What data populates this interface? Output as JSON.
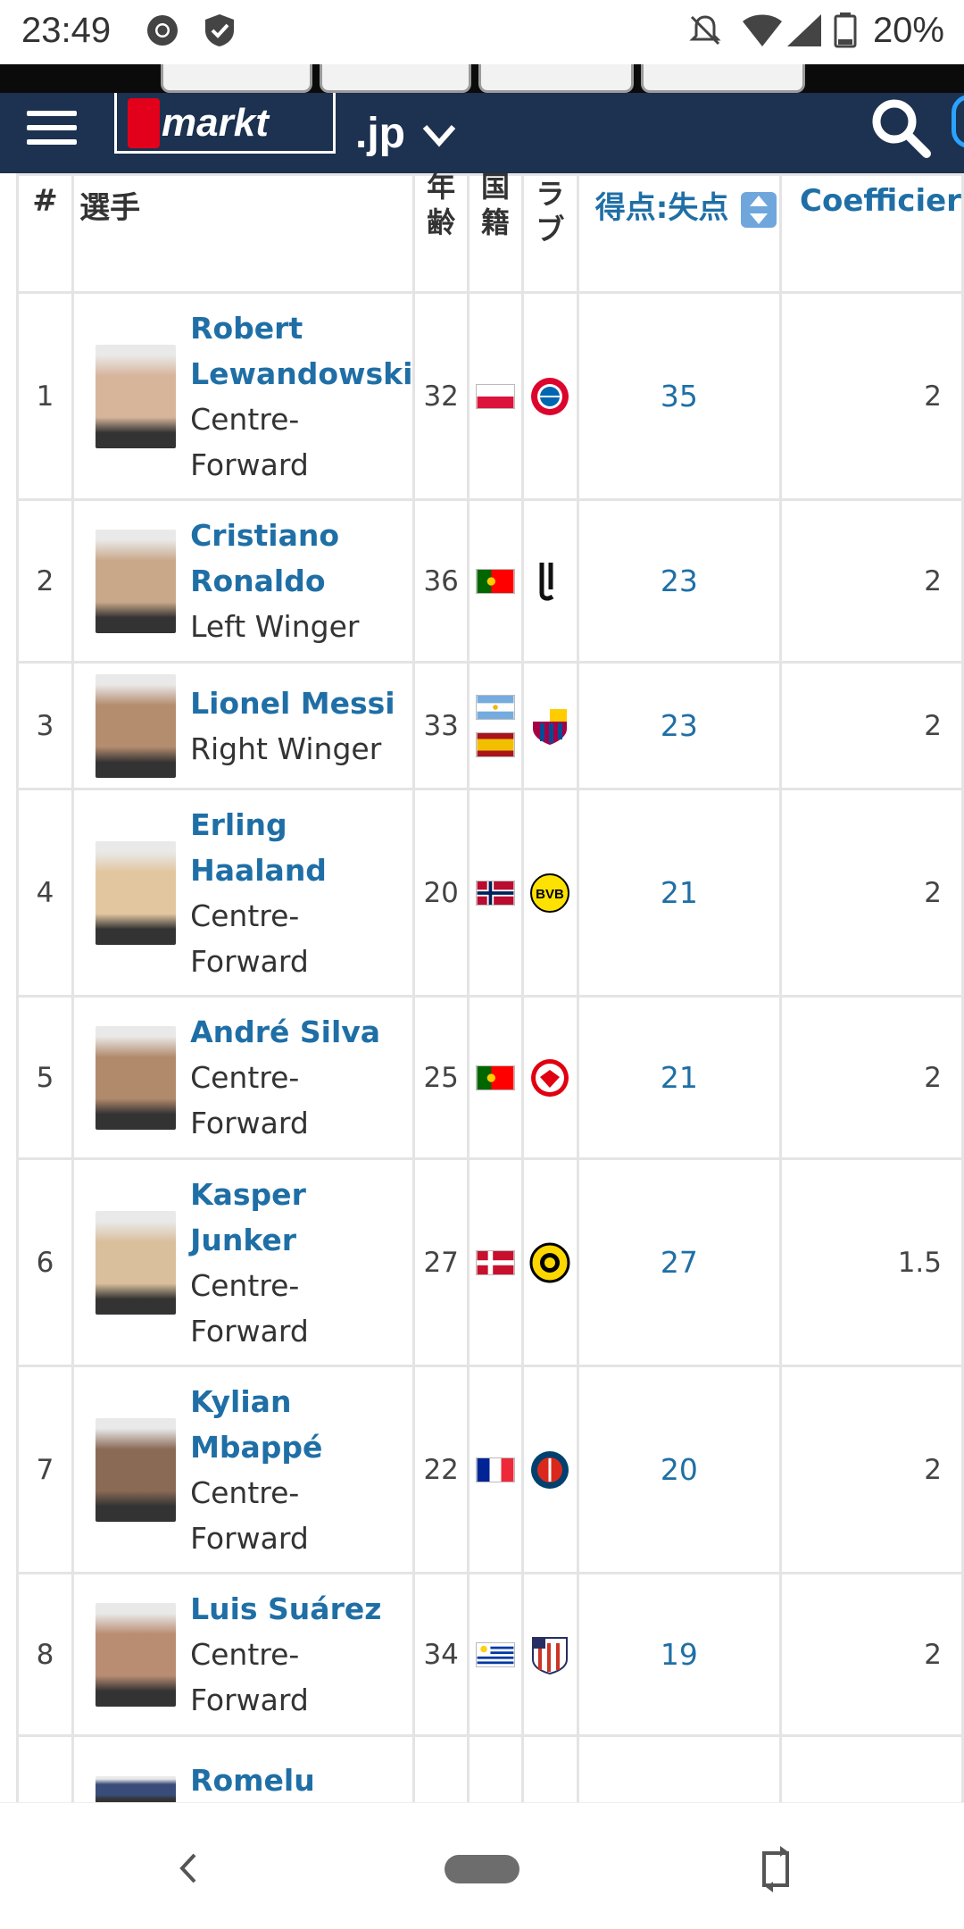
{
  "status_bar": {
    "time": "23:49",
    "battery_percent": "20%",
    "icons": [
      "chrome-icon",
      "shield-check-icon",
      "bell-off-icon",
      "wifi-icon",
      "signal-icon",
      "battery-icon"
    ]
  },
  "header": {
    "logo_text": "transfermarkt",
    "logo_text_line2": "markt",
    "language": ".jp",
    "colors": {
      "header_bg": "#1d3150",
      "link_blue": "#1f6fa6",
      "brand_red": "#e3001b"
    }
  },
  "table": {
    "columns": {
      "rank": "#",
      "player": "選手",
      "age": "年齢",
      "nationality": "国籍",
      "club": "ラブ",
      "goals": "得点:失点",
      "coefficient": "Coefficier"
    },
    "rows": [
      {
        "rank": "1",
        "name": "Robert Lewandowski",
        "position": "Centre-Forward",
        "age": "32",
        "flags": [
          "poland"
        ],
        "club": "bayern",
        "goals": "35",
        "coef": "2"
      },
      {
        "rank": "2",
        "name": "Cristiano Ronaldo",
        "position": "Left Winger",
        "age": "36",
        "flags": [
          "portugal"
        ],
        "club": "juventus",
        "goals": "23",
        "coef": "2"
      },
      {
        "rank": "3",
        "name": "Lionel Messi",
        "position": "Right Winger",
        "age": "33",
        "flags": [
          "argentina",
          "spain"
        ],
        "club": "barcelona",
        "goals": "23",
        "coef": "2"
      },
      {
        "rank": "4",
        "name": "Erling Haaland",
        "position": "Centre-Forward",
        "age": "20",
        "flags": [
          "norway"
        ],
        "club": "dortmund",
        "goals": "21",
        "coef": "2"
      },
      {
        "rank": "5",
        "name": "André Silva",
        "position": "Centre-Forward",
        "age": "25",
        "flags": [
          "portugal"
        ],
        "club": "frankfurt",
        "goals": "21",
        "coef": "2"
      },
      {
        "rank": "6",
        "name": "Kasper Junker",
        "position": "Centre-Forward",
        "age": "27",
        "flags": [
          "denmark"
        ],
        "club": "bodo-glimt",
        "goals": "27",
        "coef": "1.5"
      },
      {
        "rank": "7",
        "name": "Kylian Mbappé",
        "position": "Centre-Forward",
        "age": "22",
        "flags": [
          "france"
        ],
        "club": "psg",
        "goals": "20",
        "coef": "2"
      },
      {
        "rank": "8",
        "name": "Luis Suárez",
        "position": "Centre-Forward",
        "age": "34",
        "flags": [
          "uruguay"
        ],
        "club": "atletico",
        "goals": "19",
        "coef": "2"
      },
      {
        "rank": "",
        "name": "Romelu",
        "position": "",
        "age": "",
        "flags": [],
        "club": "",
        "goals": "",
        "coef": ""
      }
    ]
  }
}
